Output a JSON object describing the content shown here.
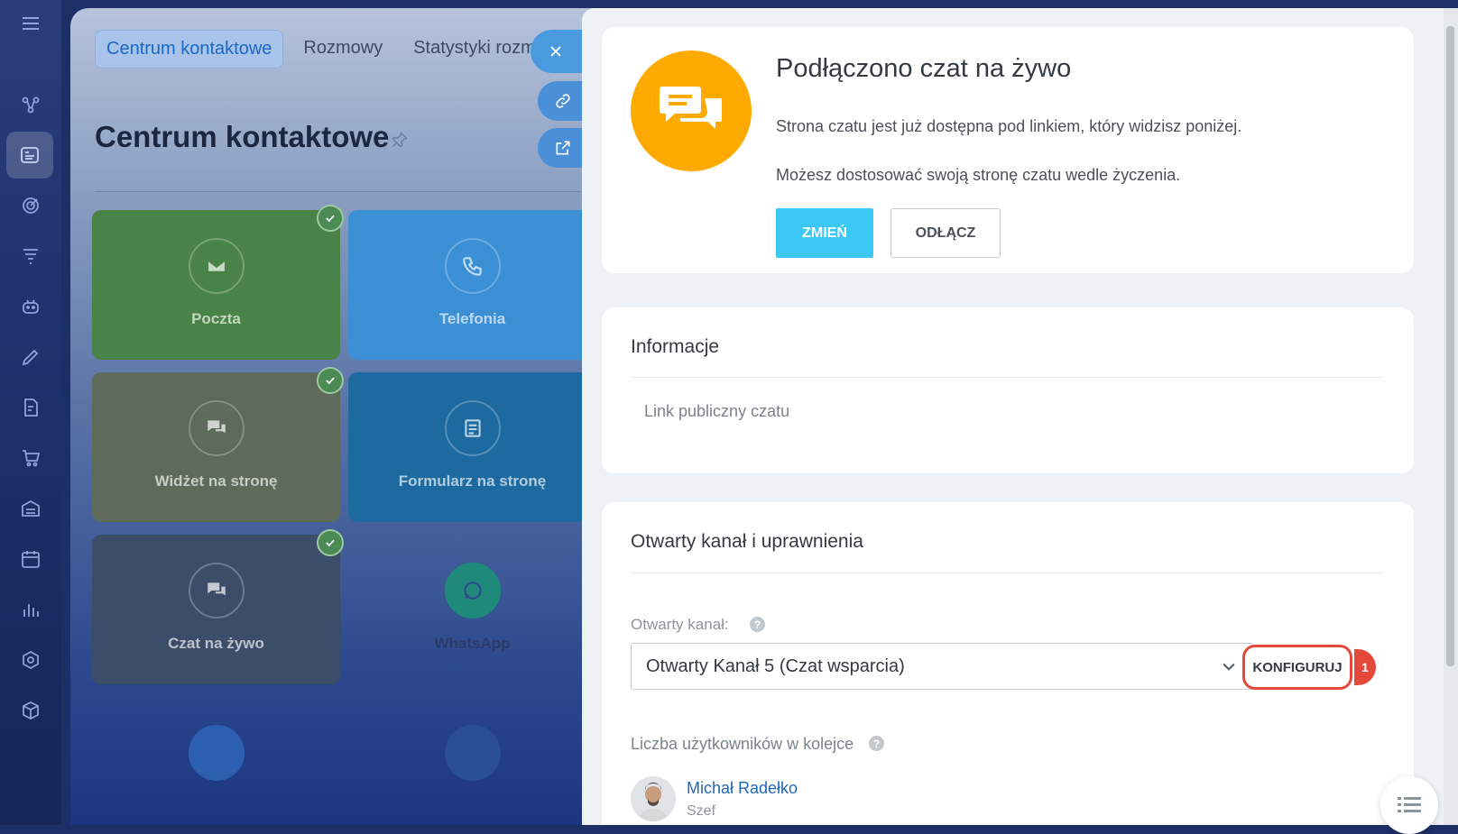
{
  "background": {
    "tabs": [
      "Centrum kontaktowe",
      "Rozmowy",
      "Statystyki rozm"
    ],
    "title": "Centrum kontaktowe",
    "tiles": [
      {
        "label": "Poczta",
        "icon": "mail-icon",
        "color": "#4a8347",
        "checked": true
      },
      {
        "label": "Telefonia",
        "icon": "phone-icon",
        "color": "#3b8fd4",
        "checked": false
      },
      {
        "label": "Widżet na stronę",
        "icon": "chat-bubbles-icon",
        "color": "#5e6a5a",
        "checked": true
      },
      {
        "label": "Formularz na stronę",
        "icon": "form-icon",
        "color": "#1d6aa1",
        "checked": false
      },
      {
        "label": "Czat na żywo",
        "icon": "chat-bubbles-icon",
        "color": "#3c4d6a",
        "checked": true
      },
      {
        "label": "WhatsApp",
        "icon": "whatsapp-icon",
        "color": "transparent",
        "checked": false
      }
    ]
  },
  "card1": {
    "heading": "Podłączono czat na żywo",
    "text1": "Strona czatu jest już dostępna pod linkiem, który widzisz poniżej.",
    "text2": "Możesz dostosować swoją stronę czatu wedle życzenia.",
    "change_label": "ZMIEŃ",
    "disconnect_label": "ODŁĄCZ"
  },
  "card2": {
    "heading": "Informacje",
    "link_label": "Link publiczny czatu"
  },
  "card3": {
    "heading": "Otwarty kanał i uprawnienia",
    "channel_label": "Otwarty kanał:",
    "channel_value": "Otwarty Kanał 5 (Czat wsparcia)",
    "configure_label": "KONFIGURUJ",
    "badge": "1",
    "queue_label": "Liczba użytkowników w kolejce",
    "user_name": "Michał Radełko",
    "user_role": "Szef"
  },
  "colors": {
    "accent_orange": "#ffaa00",
    "button_blue": "#3bc8f5",
    "highlight_red": "#e3483b",
    "link_blue": "#1f67b0"
  }
}
